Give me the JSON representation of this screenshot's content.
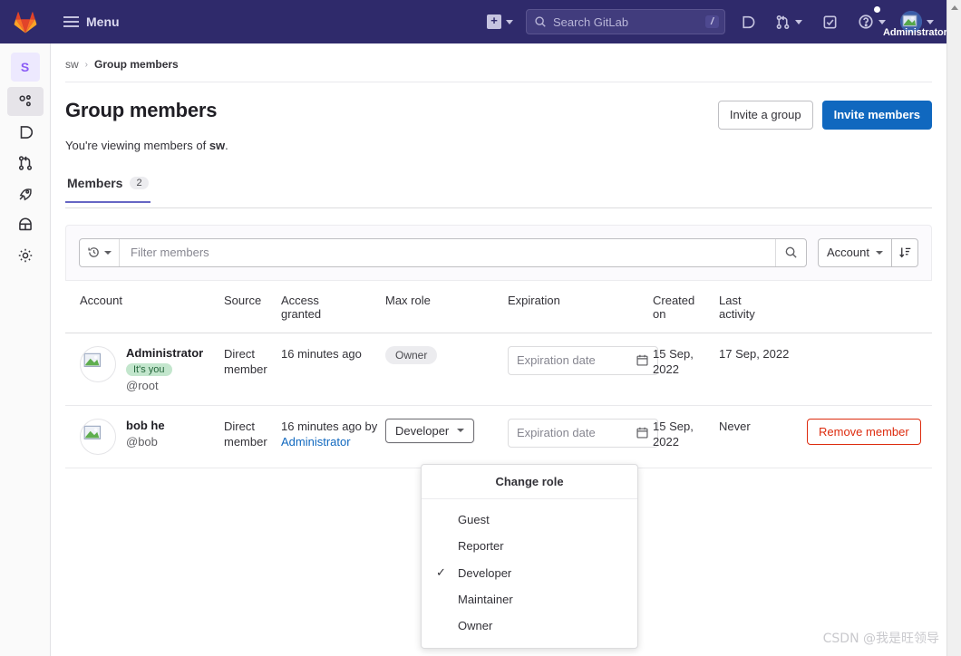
{
  "nav": {
    "logo": "gitlab-logo",
    "menu_label": "Menu",
    "create_icon": "plus-square-icon",
    "search_placeholder": "Search GitLab",
    "search_shortcut": "/",
    "issues_icon": "issues-icon",
    "merge_requests_icon": "merge-request-icon",
    "todos_icon": "todo-check-icon",
    "help_icon": "help-question-icon",
    "user_avatar": "user-avatar",
    "user_name": "Administrator"
  },
  "rail": {
    "group_initial": "S",
    "items": [
      {
        "icon": "group-members-icon",
        "name": "sidebar-item-members",
        "active": true
      },
      {
        "icon": "issues-icon",
        "name": "sidebar-item-issues",
        "active": false
      },
      {
        "icon": "merge-requests-icon",
        "name": "sidebar-item-merge-requests",
        "active": false
      },
      {
        "icon": "rocket-icon",
        "name": "sidebar-item-cicd",
        "active": false
      },
      {
        "icon": "package-icon",
        "name": "sidebar-item-packages",
        "active": false
      },
      {
        "icon": "gear-icon",
        "name": "sidebar-item-settings",
        "active": false
      }
    ]
  },
  "breadcrumb": {
    "group": "sw",
    "separator": "›",
    "current": "Group members"
  },
  "page": {
    "title": "Group members",
    "subtitle_prefix": "You're viewing members of ",
    "subtitle_group": "sw",
    "subtitle_suffix": ".",
    "invite_group_label": "Invite a group",
    "invite_members_label": "Invite members"
  },
  "tabs": [
    {
      "label": "Members",
      "count": "2"
    }
  ],
  "filter": {
    "history_icon": "history-icon",
    "placeholder": "Filter members",
    "search_icon": "search-icon",
    "sort_field": "Account",
    "sort_direction_icon": "sort-descending-icon"
  },
  "table": {
    "columns": [
      "Account",
      "Source",
      "Access granted",
      "Max role",
      "Expiration",
      "Created on",
      "Last activity"
    ],
    "col_access_line1": "Access",
    "col_access_line2": "granted",
    "col_created_line1": "Created",
    "col_created_line2": "on",
    "col_last_line1": "Last",
    "col_last_line2": "activity",
    "rows": [
      {
        "name": "Administrator",
        "you_badge": "It's you",
        "handle": "@root",
        "source": "Direct member",
        "access_granted": "16 minutes ago",
        "access_granted_by": "",
        "access_granted_by_name": "",
        "role": "Owner",
        "role_is_button": false,
        "expiration_placeholder": "Expiration date",
        "created_on": "15 Sep, 2022",
        "last_activity": "17 Sep, 2022",
        "action_label": ""
      },
      {
        "name": "bob he",
        "you_badge": "",
        "handle": "@bob",
        "source": "Direct member",
        "access_granted": "16 minutes ago by",
        "access_granted_by": "by",
        "access_granted_by_name": "Administrator",
        "role": "Developer",
        "role_is_button": true,
        "expiration_placeholder": "Expiration date",
        "created_on": "15 Sep, 2022",
        "last_activity": "Never",
        "action_label": "Remove member"
      }
    ]
  },
  "role_dropdown": {
    "header": "Change role",
    "items": [
      {
        "label": "Guest",
        "selected": false
      },
      {
        "label": "Reporter",
        "selected": false
      },
      {
        "label": "Developer",
        "selected": true
      },
      {
        "label": "Maintainer",
        "selected": false
      },
      {
        "label": "Owner",
        "selected": false
      }
    ],
    "check_glyph": "✓"
  },
  "watermark": "CSDN @我是旺领导",
  "colors": {
    "nav_bg": "#2f2a6b",
    "primary": "#1068bf",
    "danger": "#dd2b0e",
    "tab_underline": "#6666c4",
    "badge_green_bg": "#c3e6cd",
    "badge_green_text": "#24663b"
  }
}
